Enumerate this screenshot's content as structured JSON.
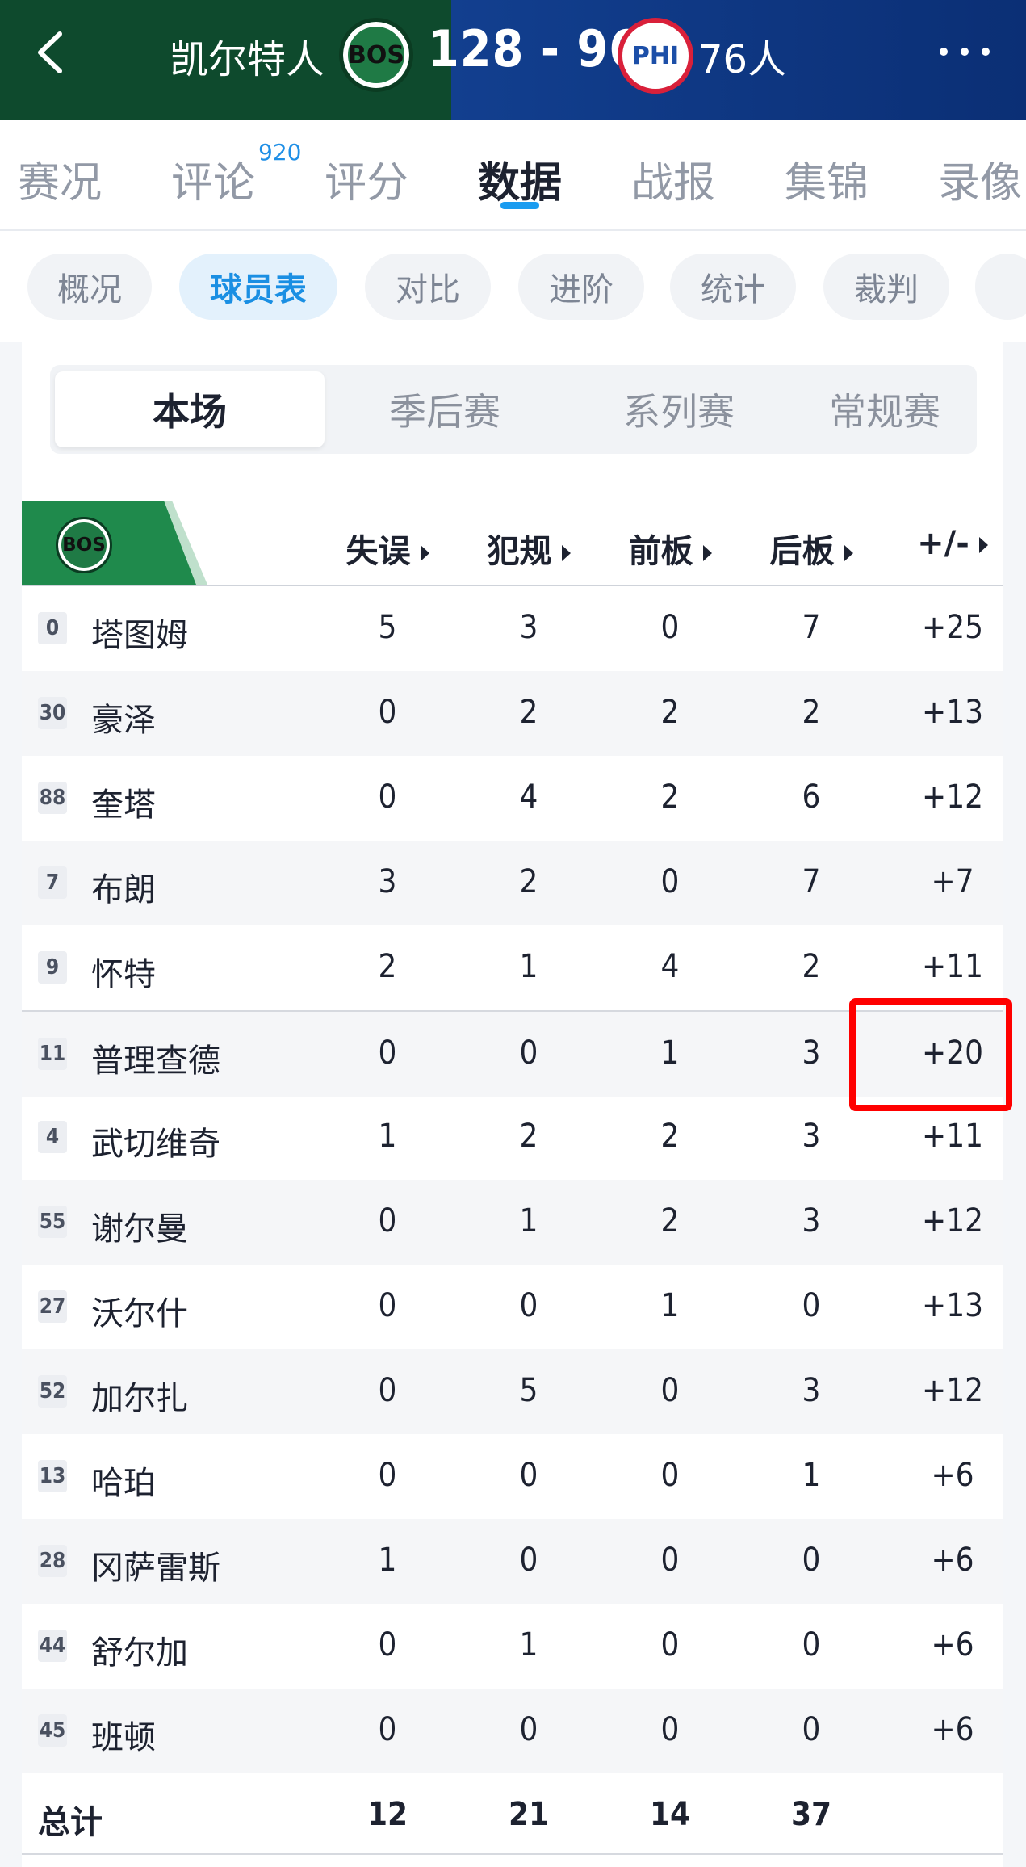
{
  "header": {
    "home_team": "凯尔特人",
    "home_logo_text": "BOS",
    "score": "128 - 96",
    "away_logo_text": "PHI",
    "away_team": "76人"
  },
  "main_tabs": [
    {
      "label": "赛况"
    },
    {
      "label": "评论",
      "sup": "920"
    },
    {
      "label": "评分"
    },
    {
      "label": "数据",
      "active": true
    },
    {
      "label": "战报"
    },
    {
      "label": "集锦"
    },
    {
      "label": "录像"
    }
  ],
  "sub_tabs": [
    {
      "label": "概况"
    },
    {
      "label": "球员表",
      "active": true
    },
    {
      "label": "对比"
    },
    {
      "label": "进阶"
    },
    {
      "label": "统计"
    },
    {
      "label": "裁判"
    }
  ],
  "segments": [
    {
      "label": "本场",
      "active": true
    },
    {
      "label": "季后赛"
    },
    {
      "label": "系列赛"
    },
    {
      "label": "常规赛"
    }
  ],
  "table": {
    "team_logo_text": "BOS",
    "columns": [
      "失误",
      "犯规",
      "前板",
      "后板",
      "+/-"
    ],
    "rows": [
      {
        "num": "0",
        "name": "塔图姆",
        "vals": [
          "5",
          "3",
          "0",
          "7",
          "+25"
        ]
      },
      {
        "num": "30",
        "name": "豪泽",
        "vals": [
          "0",
          "2",
          "2",
          "2",
          "+13"
        ]
      },
      {
        "num": "88",
        "name": "奎塔",
        "vals": [
          "0",
          "4",
          "2",
          "6",
          "+12"
        ]
      },
      {
        "num": "7",
        "name": "布朗",
        "vals": [
          "3",
          "2",
          "0",
          "7",
          "+7"
        ]
      },
      {
        "num": "9",
        "name": "怀特",
        "vals": [
          "2",
          "1",
          "4",
          "2",
          "+11"
        ]
      },
      {
        "num": "11",
        "name": "普理查德",
        "vals": [
          "0",
          "0",
          "1",
          "3",
          "+20"
        ]
      },
      {
        "num": "4",
        "name": "武切维奇",
        "vals": [
          "1",
          "2",
          "2",
          "3",
          "+11"
        ]
      },
      {
        "num": "55",
        "name": "谢尔曼",
        "vals": [
          "0",
          "1",
          "2",
          "3",
          "+12"
        ]
      },
      {
        "num": "27",
        "name": "沃尔什",
        "vals": [
          "0",
          "0",
          "1",
          "0",
          "+13"
        ]
      },
      {
        "num": "52",
        "name": "加尔扎",
        "vals": [
          "0",
          "5",
          "0",
          "3",
          "+12"
        ]
      },
      {
        "num": "13",
        "name": "哈珀",
        "vals": [
          "0",
          "0",
          "0",
          "1",
          "+6"
        ]
      },
      {
        "num": "28",
        "name": "冈萨雷斯",
        "vals": [
          "1",
          "0",
          "0",
          "0",
          "+6"
        ]
      },
      {
        "num": "44",
        "name": "舒尔加",
        "vals": [
          "0",
          "1",
          "0",
          "0",
          "+6"
        ]
      },
      {
        "num": "45",
        "name": "班顿",
        "vals": [
          "0",
          "0",
          "0",
          "0",
          "+6"
        ]
      }
    ],
    "total": {
      "label": "总计",
      "vals": [
        "12",
        "21",
        "14",
        "37",
        ""
      ]
    }
  },
  "colors": {
    "header_home": "#0e4a2d",
    "header_away": "#123f8f",
    "accent": "#1a9cf0",
    "highlight": "#ff0000",
    "team_green": "#1f7a45"
  },
  "icons": [
    "back-arrow-icon",
    "more-dots-icon"
  ]
}
